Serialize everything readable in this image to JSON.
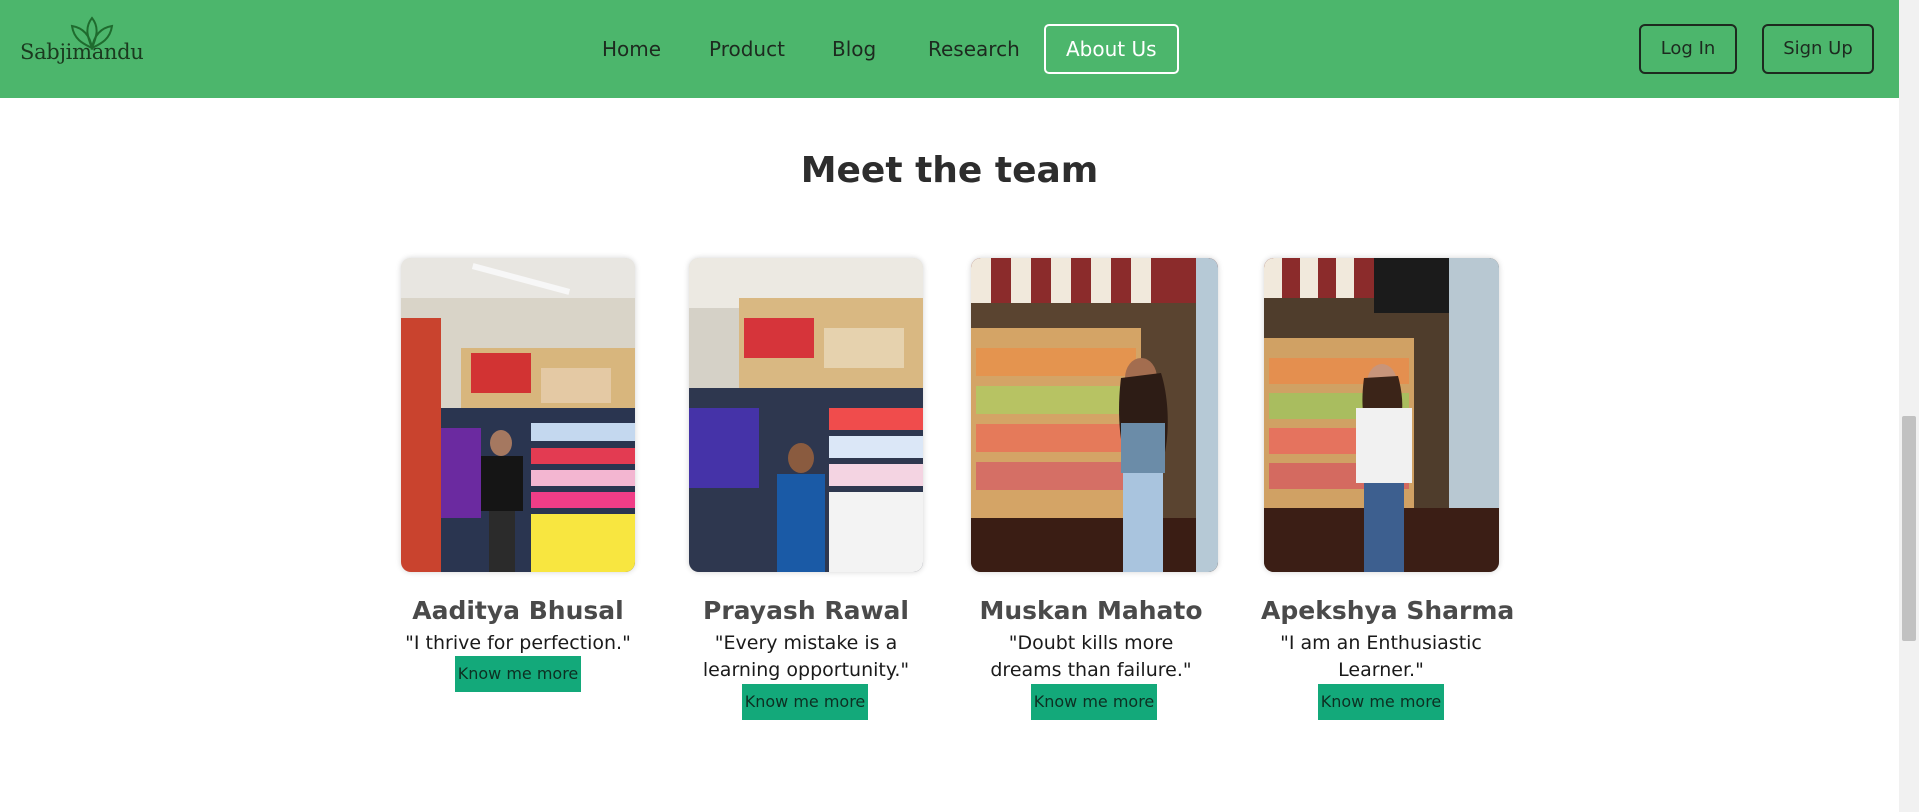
{
  "brand": {
    "name": "Sabjimandu",
    "color": "#4cb66c"
  },
  "nav": {
    "links": [
      "Home",
      "Product",
      "Blog",
      "Research",
      "About Us"
    ],
    "active": "About Us"
  },
  "auth": {
    "login": "Log In",
    "signup": "Sign Up"
  },
  "team": {
    "title": "Meet the team",
    "button_label": "Know me more",
    "members": [
      {
        "name": "Aaditya Bhusal",
        "quote": "\"I thrive for perfection.\""
      },
      {
        "name": "Prayash Rawal",
        "quote": "\"Every mistake is a learning opportunity.\""
      },
      {
        "name": "Muskan Mahato",
        "quote": "\"Doubt kills more dreams than failure.\""
      },
      {
        "name": "Apekshya Sharma",
        "quote": "\"I am an Enthusiastic Learner.\""
      }
    ]
  },
  "icons": [
    "leaf-logo-icon"
  ]
}
